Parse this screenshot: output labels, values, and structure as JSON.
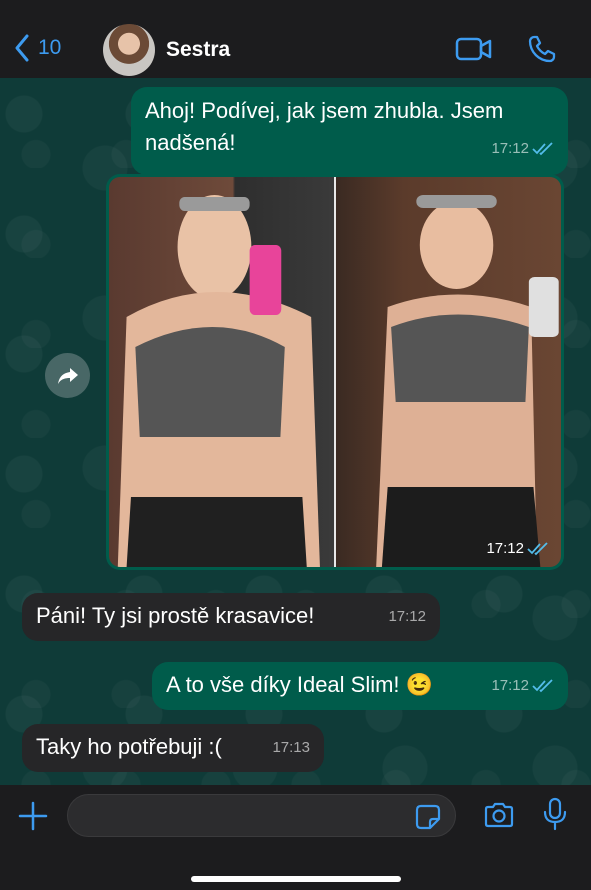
{
  "header": {
    "back_count": "10",
    "contact_name": "Sestra"
  },
  "messages": [
    {
      "direction": "out",
      "text": "Ahoj! Podívej, jak jsem zhubla. Jsem nadšená!",
      "time": "17:12",
      "read": true
    },
    {
      "direction": "out",
      "type": "photo",
      "time": "17:12",
      "read": true
    },
    {
      "direction": "in",
      "text": "Páni! Ty jsi prostě krasavice!",
      "time": "17:12"
    },
    {
      "direction": "out",
      "text": "A to vše díky Ideal Slim! 😉",
      "time": "17:12",
      "read": true
    },
    {
      "direction": "in",
      "text": "Taky ho potřebuji :(",
      "time": "17:13"
    }
  ],
  "composer": {
    "placeholder": "",
    "value": ""
  },
  "colors": {
    "accent": "#3d9bf0",
    "outgoing_bubble": "#005c4b",
    "incoming_bubble": "#262628",
    "chat_background": "#0f3b38",
    "read_ticks": "#53bdeb"
  },
  "icons": [
    "chevron-left-icon",
    "video-call-icon",
    "phone-icon",
    "forward-icon",
    "plus-icon",
    "sticker-icon",
    "camera-icon",
    "microphone-icon",
    "double-check-icon"
  ]
}
